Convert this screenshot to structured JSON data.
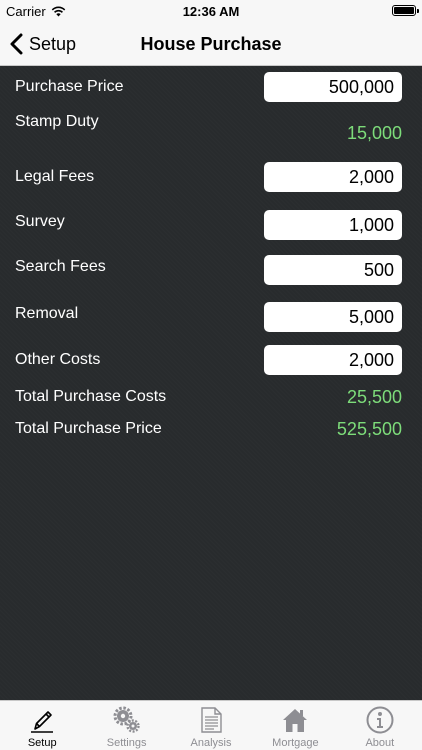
{
  "status": {
    "carrier": "Carrier",
    "time": "12:36 AM"
  },
  "nav": {
    "back_label": "Setup",
    "title": "House Purchase"
  },
  "rows": [
    {
      "label": "Purchase Price",
      "value": "500,000",
      "kind": "input"
    },
    {
      "label": "Stamp Duty",
      "value": "15,000",
      "kind": "output"
    },
    {
      "label": "Legal Fees",
      "value": "2,000",
      "kind": "input"
    },
    {
      "label": "Survey",
      "value": "1,000",
      "kind": "input"
    },
    {
      "label": "Search Fees",
      "value": "500",
      "kind": "input"
    },
    {
      "label": "Removal",
      "value": "5,000",
      "kind": "input"
    },
    {
      "label": "Other Costs",
      "value": "2,000",
      "kind": "input"
    },
    {
      "label": "Total Purchase Costs",
      "value": "25,500",
      "kind": "output"
    },
    {
      "label": "Total Purchase Price",
      "value": "525,500",
      "kind": "output"
    }
  ],
  "tabs": [
    {
      "label": "Setup",
      "icon": "pencil-icon",
      "active": true
    },
    {
      "label": "Settings",
      "icon": "gears-icon",
      "active": false
    },
    {
      "label": "Analysis",
      "icon": "document-icon",
      "active": false
    },
    {
      "label": "Mortgage",
      "icon": "house-icon",
      "active": false
    },
    {
      "label": "About",
      "icon": "info-icon",
      "active": false
    }
  ],
  "colors": {
    "background": "#282b2d",
    "bar_background": "#f7f7f7",
    "computed_value": "#7ddc7a",
    "tab_inactive": "#8e8e93",
    "tab_active": "#000000"
  }
}
